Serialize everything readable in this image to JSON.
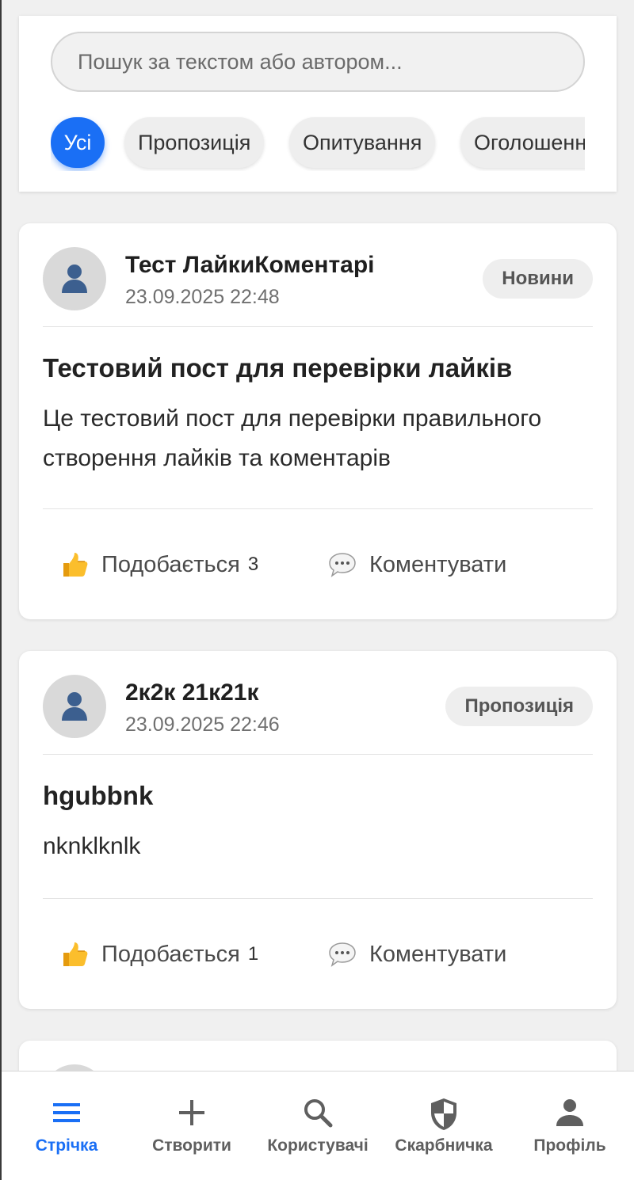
{
  "search": {
    "placeholder": "Пошук за текстом або автором..."
  },
  "filters": [
    {
      "label": "Усі",
      "active": true
    },
    {
      "label": "Пропозиція",
      "active": false
    },
    {
      "label": "Опитування",
      "active": false
    },
    {
      "label": "Оголошення",
      "active": false
    }
  ],
  "posts": [
    {
      "author": "Тест ЛайкиКоментарі",
      "date": "23.09.2025 22:48",
      "category": "Новини",
      "title": "Тестовий пост для перевірки лайків",
      "body": "Це тестовий пост для перевірки правильного створення лайків та коментарів",
      "like_label": "Подобається",
      "like_count": "3",
      "comment_label": "Коментувати"
    },
    {
      "author": "2к2к 21к21к",
      "date": "23.09.2025 22:46",
      "category": "Пропозиція",
      "title": "hgubbnk",
      "body": "nknklknlk",
      "like_label": "Подобається",
      "like_count": "1",
      "comment_label": "Коментувати"
    }
  ],
  "bottom_nav": [
    {
      "label": "Стрічка",
      "icon": "menu-icon",
      "active": true
    },
    {
      "label": "Створити",
      "icon": "plus-icon",
      "active": false
    },
    {
      "label": "Користувачі",
      "icon": "search-icon",
      "active": false
    },
    {
      "label": "Скарбничка",
      "icon": "shield-icon",
      "active": false
    },
    {
      "label": "Профіль",
      "icon": "person-icon",
      "active": false
    }
  ],
  "colors": {
    "accent": "#1a6ff5",
    "background": "#f0f0f0",
    "card": "#ffffff",
    "badge": "#eeeeee"
  }
}
